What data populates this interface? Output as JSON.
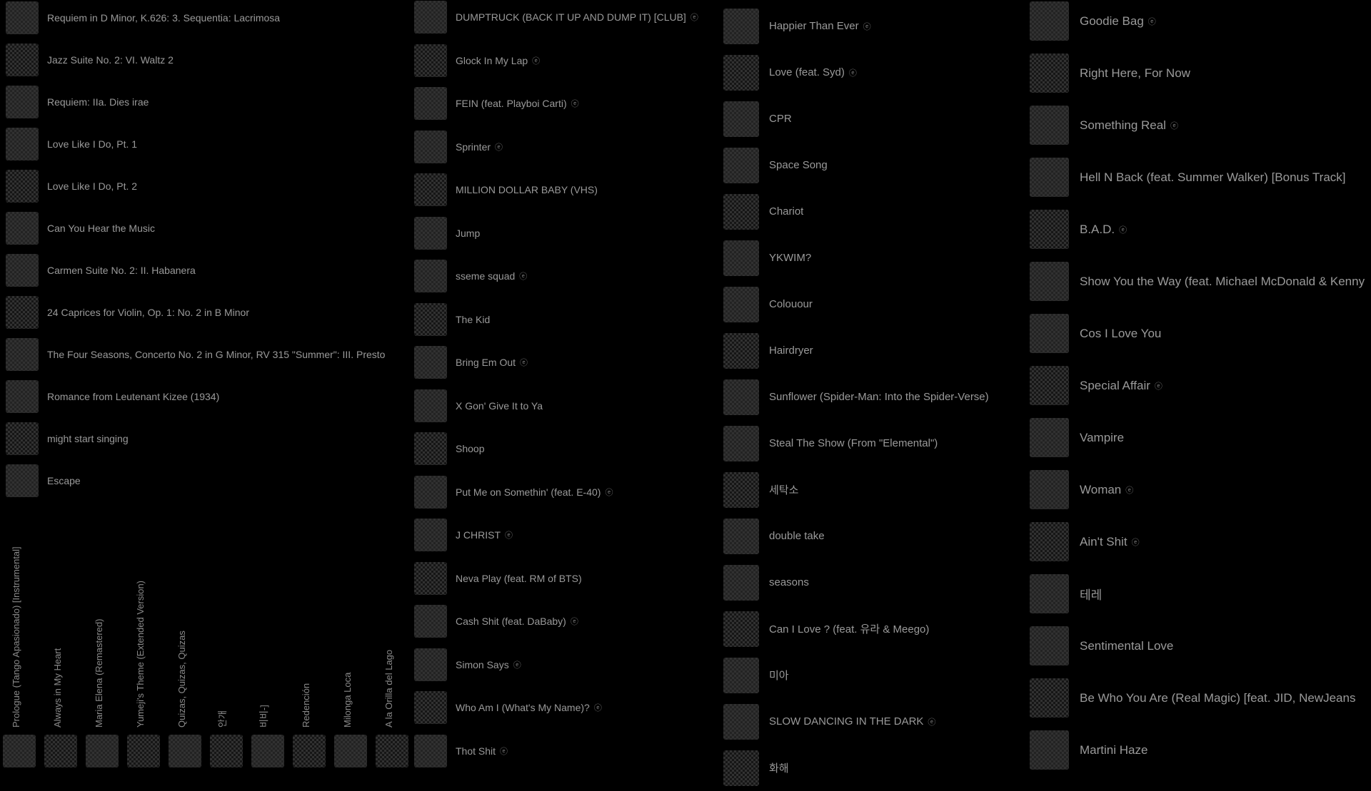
{
  "columns": [
    {
      "items": [
        {
          "title": "Requiem in D Minor, K.626: 3. Sequentia: Lacrimosa",
          "explicit": false
        },
        {
          "title": "Jazz Suite No. 2: VI. Waltz 2",
          "explicit": false
        },
        {
          "title": "Requiem: IIa. Dies irae",
          "explicit": false
        },
        {
          "title": "Love Like I Do, Pt. 1",
          "explicit": false
        },
        {
          "title": "Love Like I Do, Pt. 2",
          "explicit": false
        },
        {
          "title": "Can You Hear the Music",
          "explicit": false
        },
        {
          "title": "Carmen Suite No. 2: II. Habanera",
          "explicit": false
        },
        {
          "title": "24 Caprices for Violin, Op. 1: No. 2 in B Minor",
          "explicit": false
        },
        {
          "title": "The Four Seasons, Concerto No. 2 in G Minor, RV 315 \"Summer\": III. Presto",
          "explicit": false
        },
        {
          "title": "Romance from Leutenant Kizee (1934)",
          "explicit": false
        },
        {
          "title": "might start singing",
          "explicit": false
        },
        {
          "title": "Escape",
          "explicit": false
        }
      ]
    },
    {
      "items": [
        {
          "title": "DUMPTRUCK (BACK IT UP AND DUMP IT) [CLUB]",
          "explicit": true
        },
        {
          "title": "Glock In My Lap",
          "explicit": true
        },
        {
          "title": "FEIN (feat. Playboi Carti)",
          "explicit": true
        },
        {
          "title": "Sprinter",
          "explicit": true
        },
        {
          "title": "MILLION DOLLAR BABY (VHS)",
          "explicit": false
        },
        {
          "title": "Jump",
          "explicit": false
        },
        {
          "title": "sseme squad",
          "explicit": true
        },
        {
          "title": "The Kid",
          "explicit": false
        },
        {
          "title": "Bring Em Out",
          "explicit": true
        },
        {
          "title": "X Gon' Give It to Ya",
          "explicit": false
        },
        {
          "title": "Shoop",
          "explicit": false
        },
        {
          "title": "Put Me on Somethin' (feat. E-40)",
          "explicit": true
        },
        {
          "title": "J CHRIST",
          "explicit": true
        },
        {
          "title": "Neva Play (feat. RM of BTS)",
          "explicit": false
        },
        {
          "title": "Cash Shit (feat. DaBaby)",
          "explicit": true
        },
        {
          "title": "Simon Says",
          "explicit": true
        },
        {
          "title": "Who Am I (What's My Name)?",
          "explicit": true
        },
        {
          "title": "Thot Shit",
          "explicit": true
        }
      ]
    },
    {
      "items": [
        {
          "title": "Happier Than Ever",
          "explicit": true
        },
        {
          "title": "Love (feat. Syd)",
          "explicit": true
        },
        {
          "title": "CPR",
          "explicit": false
        },
        {
          "title": "Space Song",
          "explicit": false
        },
        {
          "title": "Chariot",
          "explicit": false
        },
        {
          "title": "YKWIM?",
          "explicit": false
        },
        {
          "title": "Colouour",
          "explicit": false
        },
        {
          "title": "Hairdryer",
          "explicit": false
        },
        {
          "title": "Sunflower (Spider-Man: Into the Spider-Verse)",
          "explicit": false
        },
        {
          "title": "Steal The Show (From \"Elemental\")",
          "explicit": false
        },
        {
          "title": "세탁소",
          "explicit": false
        },
        {
          "title": "double take",
          "explicit": false
        },
        {
          "title": "seasons",
          "explicit": false
        },
        {
          "title": "Can I Love ? (feat. 유라 & Meego)",
          "explicit": false
        },
        {
          "title": "미아",
          "explicit": false
        },
        {
          "title": "SLOW DANCING IN THE DARK",
          "explicit": true
        },
        {
          "title": "화해",
          "explicit": false
        }
      ]
    },
    {
      "items": [
        {
          "title": "Goodie Bag",
          "explicit": true
        },
        {
          "title": "Right Here, For Now",
          "explicit": false
        },
        {
          "title": "Something Real",
          "explicit": true
        },
        {
          "title": "Hell N Back (feat. Summer Walker) [Bonus Track]",
          "explicit": false
        },
        {
          "title": "B.A.D.",
          "explicit": true
        },
        {
          "title": "Show You the Way (feat. Michael McDonald & Kenny Loggins)",
          "explicit": false
        },
        {
          "title": "Cos I Love You",
          "explicit": false
        },
        {
          "title": "Special Affair",
          "explicit": true
        },
        {
          "title": "Vampire",
          "explicit": false
        },
        {
          "title": "Woman",
          "explicit": true
        },
        {
          "title": "Ain't Shit",
          "explicit": true
        },
        {
          "title": "테레",
          "explicit": false
        },
        {
          "title": "Sentimental Love",
          "explicit": false
        },
        {
          "title": "Be Who You Are (Real Magic) [feat. JID, NewJeans",
          "explicit": false
        },
        {
          "title": "Martini Haze",
          "explicit": false
        }
      ]
    }
  ],
  "vertical_items": [
    {
      "title": "Prologue (Tango Apasionado) [Instrumental]"
    },
    {
      "title": "Always in My Heart"
    },
    {
      "title": "Maria Elena (Remastered)"
    },
    {
      "title": "Yumeji's Theme (Extended Version)"
    },
    {
      "title": "Quizas, Quizas, Quizas"
    },
    {
      "title": "안개"
    },
    {
      "title": "비비-]"
    },
    {
      "title": "Redención"
    },
    {
      "title": "Milonga Loca"
    },
    {
      "title": "A la Orilla del Lago"
    }
  ],
  "icons": {
    "explicit": "explicit-badge-icon"
  }
}
